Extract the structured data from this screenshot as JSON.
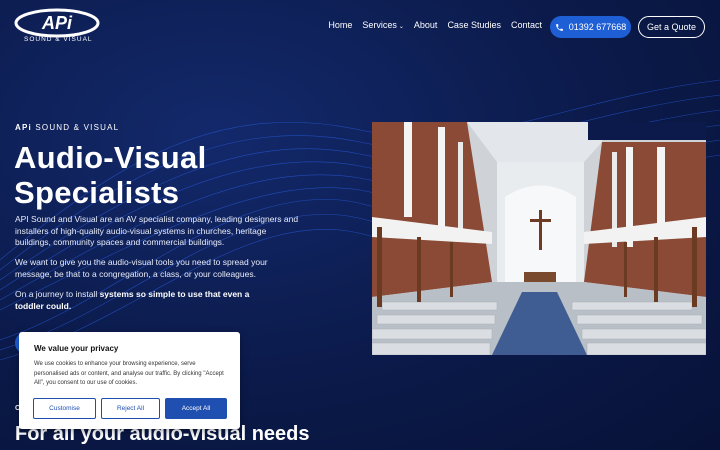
{
  "brand": {
    "logo_text": "APi",
    "logo_sub": "SOUND & VISUAL"
  },
  "nav": {
    "items": [
      "Home",
      "Services",
      "About",
      "Case Studies",
      "Contact"
    ],
    "phone": "01392 677668",
    "quote": "Get a Quote"
  },
  "hero": {
    "eyebrow_bold": "APi",
    "eyebrow_rest": " SOUND & VISUAL",
    "headline": "Audio-Visual Specialists",
    "para1": "API Sound and Visual are an AV specialist company, leading designers and installers of high-quality audio-visual systems in churches, heritage buildings, community spaces and commercial buildings.",
    "para2": "We want to give you the audio-visual tools you need to spread your message, be that to a congregation, a class, or your colleagues.",
    "para3_start": "On a journey to install ",
    "para3_bold": "systems so simple to use that even a toddler could."
  },
  "section": {
    "small": "O",
    "title": "For all your audio-visual needs"
  },
  "cookie": {
    "title": "We value your privacy",
    "text": "We use cookies to enhance your browsing experience, serve personalised ads or content, and analyse our traffic. By clicking \"Accept All\", you consent to our use of cookies.",
    "customise": "Customise",
    "reject": "Reject All",
    "accept": "Accept All"
  },
  "colors": {
    "background": "#0b1a4a",
    "accent": "#1f5fd6",
    "cookie_button": "#1f4fb0"
  }
}
